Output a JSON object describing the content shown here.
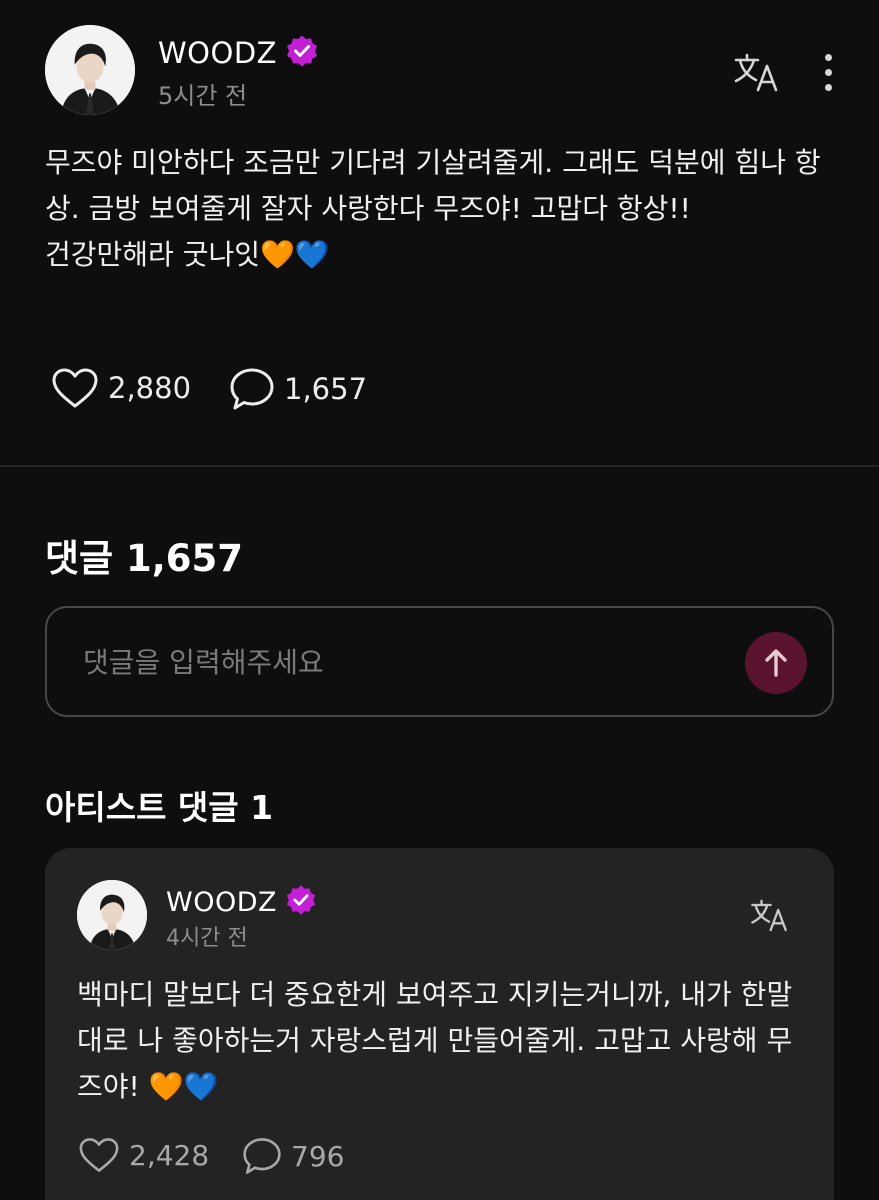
{
  "post": {
    "author": "WOODZ",
    "time": "5시간 전",
    "body": "무즈야 미안하다 조금만 기다려 기살려줄게. 그래도 덕분에 힘나 항상. 금방 보여줄게 잘자 사랑한다 무즈야! 고맙다 항상!!\n건강만해라 굿나잇🧡💙",
    "likes": "2,880",
    "comments": "1,657",
    "icons": [
      "verified-badge-icon",
      "translate-icon",
      "more-icon",
      "heart-icon",
      "comment-icon"
    ]
  },
  "comments_section": {
    "title": "댓글 1,657",
    "input_placeholder": "댓글을 입력해주세요",
    "send_icon": "arrow-up-icon"
  },
  "artist_comments": {
    "title": "아티스트 댓글 1",
    "items": [
      {
        "author": "WOODZ",
        "time": "4시간 전",
        "body": "백마디 말보다 더 중요한게 보여주고 지키는거니까, 내가 한말 대로 나 좋아하는거 자랑스럽게 만들어줄게. 고맙고 사랑해 무즈야! 🧡💙",
        "likes": "2,428",
        "comments": "796"
      }
    ]
  },
  "colors": {
    "background": "#0e0e0e",
    "card": "#232323",
    "verified": "#c21fd6",
    "send_button": "#5a1430",
    "muted_text": "#8d8d8d"
  }
}
